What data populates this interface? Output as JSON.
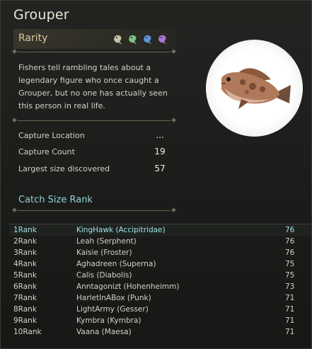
{
  "title": "Grouper",
  "rarity": {
    "label": "Rarity",
    "icons": [
      {
        "name": "fish-icon-tier1",
        "color": "#c9c2a8"
      },
      {
        "name": "fish-icon-tier2",
        "color": "#7fbf7f"
      },
      {
        "name": "fish-icon-tier3",
        "color": "#5f95d8"
      },
      {
        "name": "fish-icon-tier4",
        "color": "#a878d0"
      }
    ]
  },
  "description": "Fishers tell rambling tales about a legendary figure who once caught a Grouper, but no one has actually seen this person in real life.",
  "stats": [
    {
      "label": "Capture Location",
      "value": "..."
    },
    {
      "label": "Capture Count",
      "value": "19"
    },
    {
      "label": "Largest size discovered",
      "value": "57"
    }
  ],
  "catch_rank": {
    "heading": "Catch Size Rank",
    "rows": [
      {
        "rank": "1Rank",
        "name": "KingHawk (Accipitridae)",
        "size": "76"
      },
      {
        "rank": "2Rank",
        "name": "Leah (Serphent)",
        "size": "76"
      },
      {
        "rank": "3Rank",
        "name": "Kaisie (Froster)",
        "size": "76"
      },
      {
        "rank": "4Rank",
        "name": "Aghadreen (Superna)",
        "size": "75"
      },
      {
        "rank": "5Rank",
        "name": "Calis (Diabolis)",
        "size": "75"
      },
      {
        "rank": "6Rank",
        "name": "Anntagonizt (Hohenheimm)",
        "size": "73"
      },
      {
        "rank": "7Rank",
        "name": "HarletInABox (Punk)",
        "size": "71"
      },
      {
        "rank": "8Rank",
        "name": "LightArmy (Gesser)",
        "size": "71"
      },
      {
        "rank": "9Rank",
        "name": "Kymbra (Kymbra)",
        "size": "71"
      },
      {
        "rank": "10Rank",
        "name": "Vaana (Maesa)",
        "size": "71"
      }
    ]
  },
  "colors": {
    "title": "#e9e6da",
    "rarity_label": "#d7c9a1",
    "rank_heading": "#8fd3d6",
    "first_rank": "#9fe0e3"
  }
}
